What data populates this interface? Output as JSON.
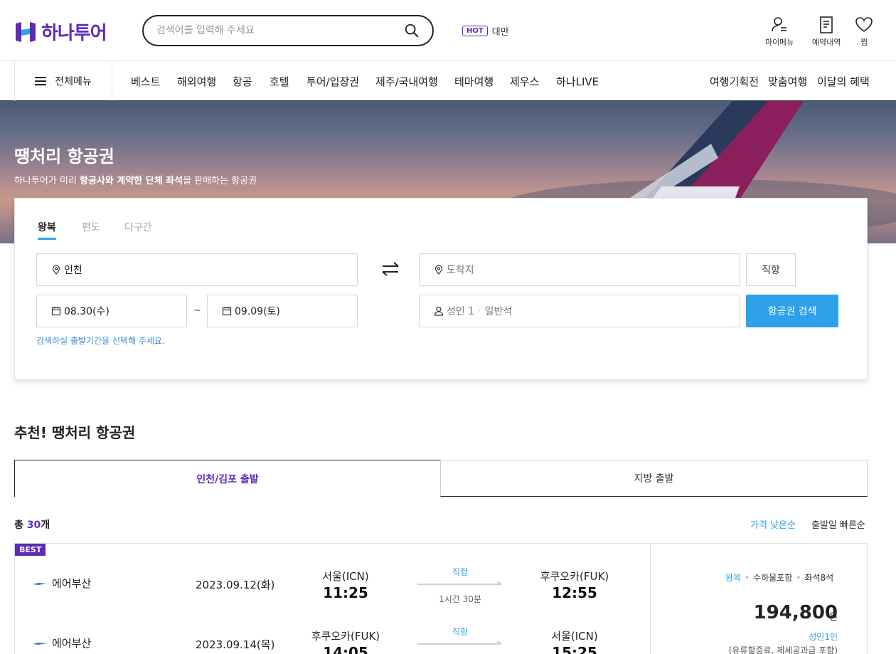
{
  "header": {
    "logo_text": "하나투어",
    "search_placeholder": "검색어를 입력해 주세요",
    "hot_badge": "HOT",
    "hot_keyword": "대만",
    "utils": [
      {
        "label": "마이메뉴",
        "icon": "user-list-icon"
      },
      {
        "label": "예약내역",
        "icon": "document-icon"
      },
      {
        "label": "찜",
        "icon": "heart-icon"
      }
    ]
  },
  "nav": {
    "all_menu": "전체메뉴",
    "items": [
      "베스트",
      "해외여행",
      "항공",
      "호텔",
      "투어/입장권",
      "제주/국내여행",
      "테마여행",
      "제우스",
      "하나LIVE"
    ],
    "right_items": [
      "여행기획전",
      "맞춤여행",
      "이달의 혜택"
    ]
  },
  "hero": {
    "title": "땡처리 항공권",
    "subtitle_prefix": "하나투어가 미리 ",
    "subtitle_bold1": "항공사와 계약한 단체 좌석",
    "subtitle_suffix": "을 판매하는 항공권"
  },
  "search_panel": {
    "tabs": [
      "왕복",
      "편도",
      "다구간"
    ],
    "active_tab": "왕복",
    "departure": "인천",
    "arrival_placeholder": "도착지",
    "direct_label": "직항",
    "date_start": "08.30(수)",
    "date_sep": "~",
    "date_end": "09.09(토)",
    "passengers": "성인 1",
    "cabin": "일반석",
    "search_button": "항공권 검색",
    "hint": "검색하실 출발기간을 선택해 주세요."
  },
  "recommend": {
    "title": "추천! 땡처리 항공권",
    "tabs": [
      "인천/김포 출발",
      "지방 출발"
    ],
    "total_prefix": "총 ",
    "total_count": "30",
    "total_suffix": "개",
    "sort_options": [
      "가격 낮은순",
      "출발일 빠른순"
    ]
  },
  "result": {
    "badge": "BEST",
    "legs": [
      {
        "airline": "에어부산",
        "date": "2023.09.12(화)",
        "from_city": "서울(ICN)",
        "from_time": "11:25",
        "type": "직항",
        "duration": "1시간 30분",
        "to_city": "후쿠오카(FUK)",
        "to_time": "12:55"
      },
      {
        "airline": "에어부산",
        "date": "2023.09.14(목)",
        "from_city": "후쿠오카(FUK)",
        "from_time": "14:05",
        "type": "직항",
        "duration": "",
        "to_city": "서울(ICN)",
        "to_time": "15:25"
      }
    ],
    "meta": [
      "왕복",
      "수하물포함",
      "좌석8석"
    ],
    "price": "194,800",
    "price_unit": "원",
    "adult_label": "성인1인",
    "fee_note": "(유류할증료, 제세공과금 포함)"
  },
  "colors": {
    "brand": "#5e2bb8",
    "accent": "#2ea1ea"
  }
}
